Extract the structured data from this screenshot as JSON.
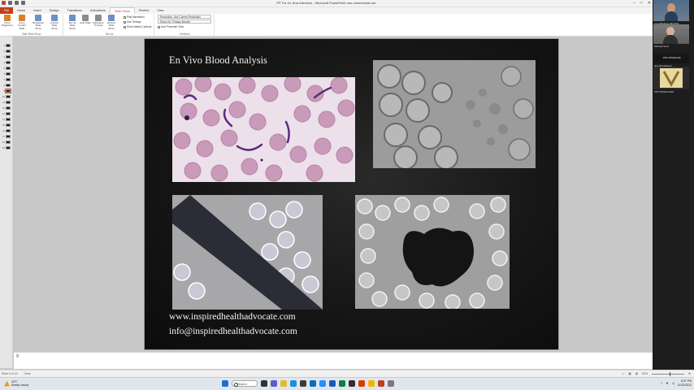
{
  "window": {
    "title": "PP For Dr. Ana Interview  -  Microsoft PowerPoint non-commercial use"
  },
  "ribbon": {
    "tabs": [
      "File",
      "Home",
      "Insert",
      "Design",
      "Transitions",
      "Animations",
      "Slide Show",
      "Review",
      "View"
    ],
    "active_tab": "Slide Show",
    "start_group": {
      "label": "Start Slide Show",
      "buttons": [
        "From Beginning",
        "From Current Slide",
        "Broadcast Slide Show",
        "Custom Slide Show"
      ]
    },
    "setup_group": {
      "label": "Set Up",
      "buttons": [
        "Set Up Slide Show",
        "Hide Slide",
        "Rehearse Timings",
        "Record Slide Show"
      ],
      "checks": [
        "Play Narrations",
        "Use Timings",
        "Show Media Controls"
      ]
    },
    "monitors_group": {
      "label": "Monitors",
      "resolution": "Resolution:  Use Current Resolution",
      "show_on": "Show On:   Primary Monitor",
      "presenter": "Use Presenter View"
    }
  },
  "thumbnails": {
    "numbers": [
      "1",
      "2",
      "3",
      "4",
      "5",
      "6",
      "7",
      "8",
      "9",
      "10",
      "11",
      "12",
      "13",
      "14",
      "15",
      "16",
      "17",
      "18",
      "19"
    ],
    "current_index": 8
  },
  "slide": {
    "title": "En Vivo Blood Analysis",
    "website": "www.inspiredhealthadvocate.com",
    "email": "info@inspiredhealthadvocate.com"
  },
  "notes": {
    "text": "9"
  },
  "participants": {
    "names": [
      "Ana Mihalcea MD PhD",
      "Michael Scott",
      "PPF MISSOURI",
      "Jan McCullough",
      "PPF PRODUCER"
    ]
  },
  "status": {
    "slide_info": "Slide 9 of 19",
    "theme": "Clear",
    "zoom": "60%"
  },
  "taskbar": {
    "temperature": "43°F",
    "weather": "Mostly cloudy",
    "search_label": "Search",
    "time": "6:57 PM",
    "date": "11/22/2022"
  }
}
